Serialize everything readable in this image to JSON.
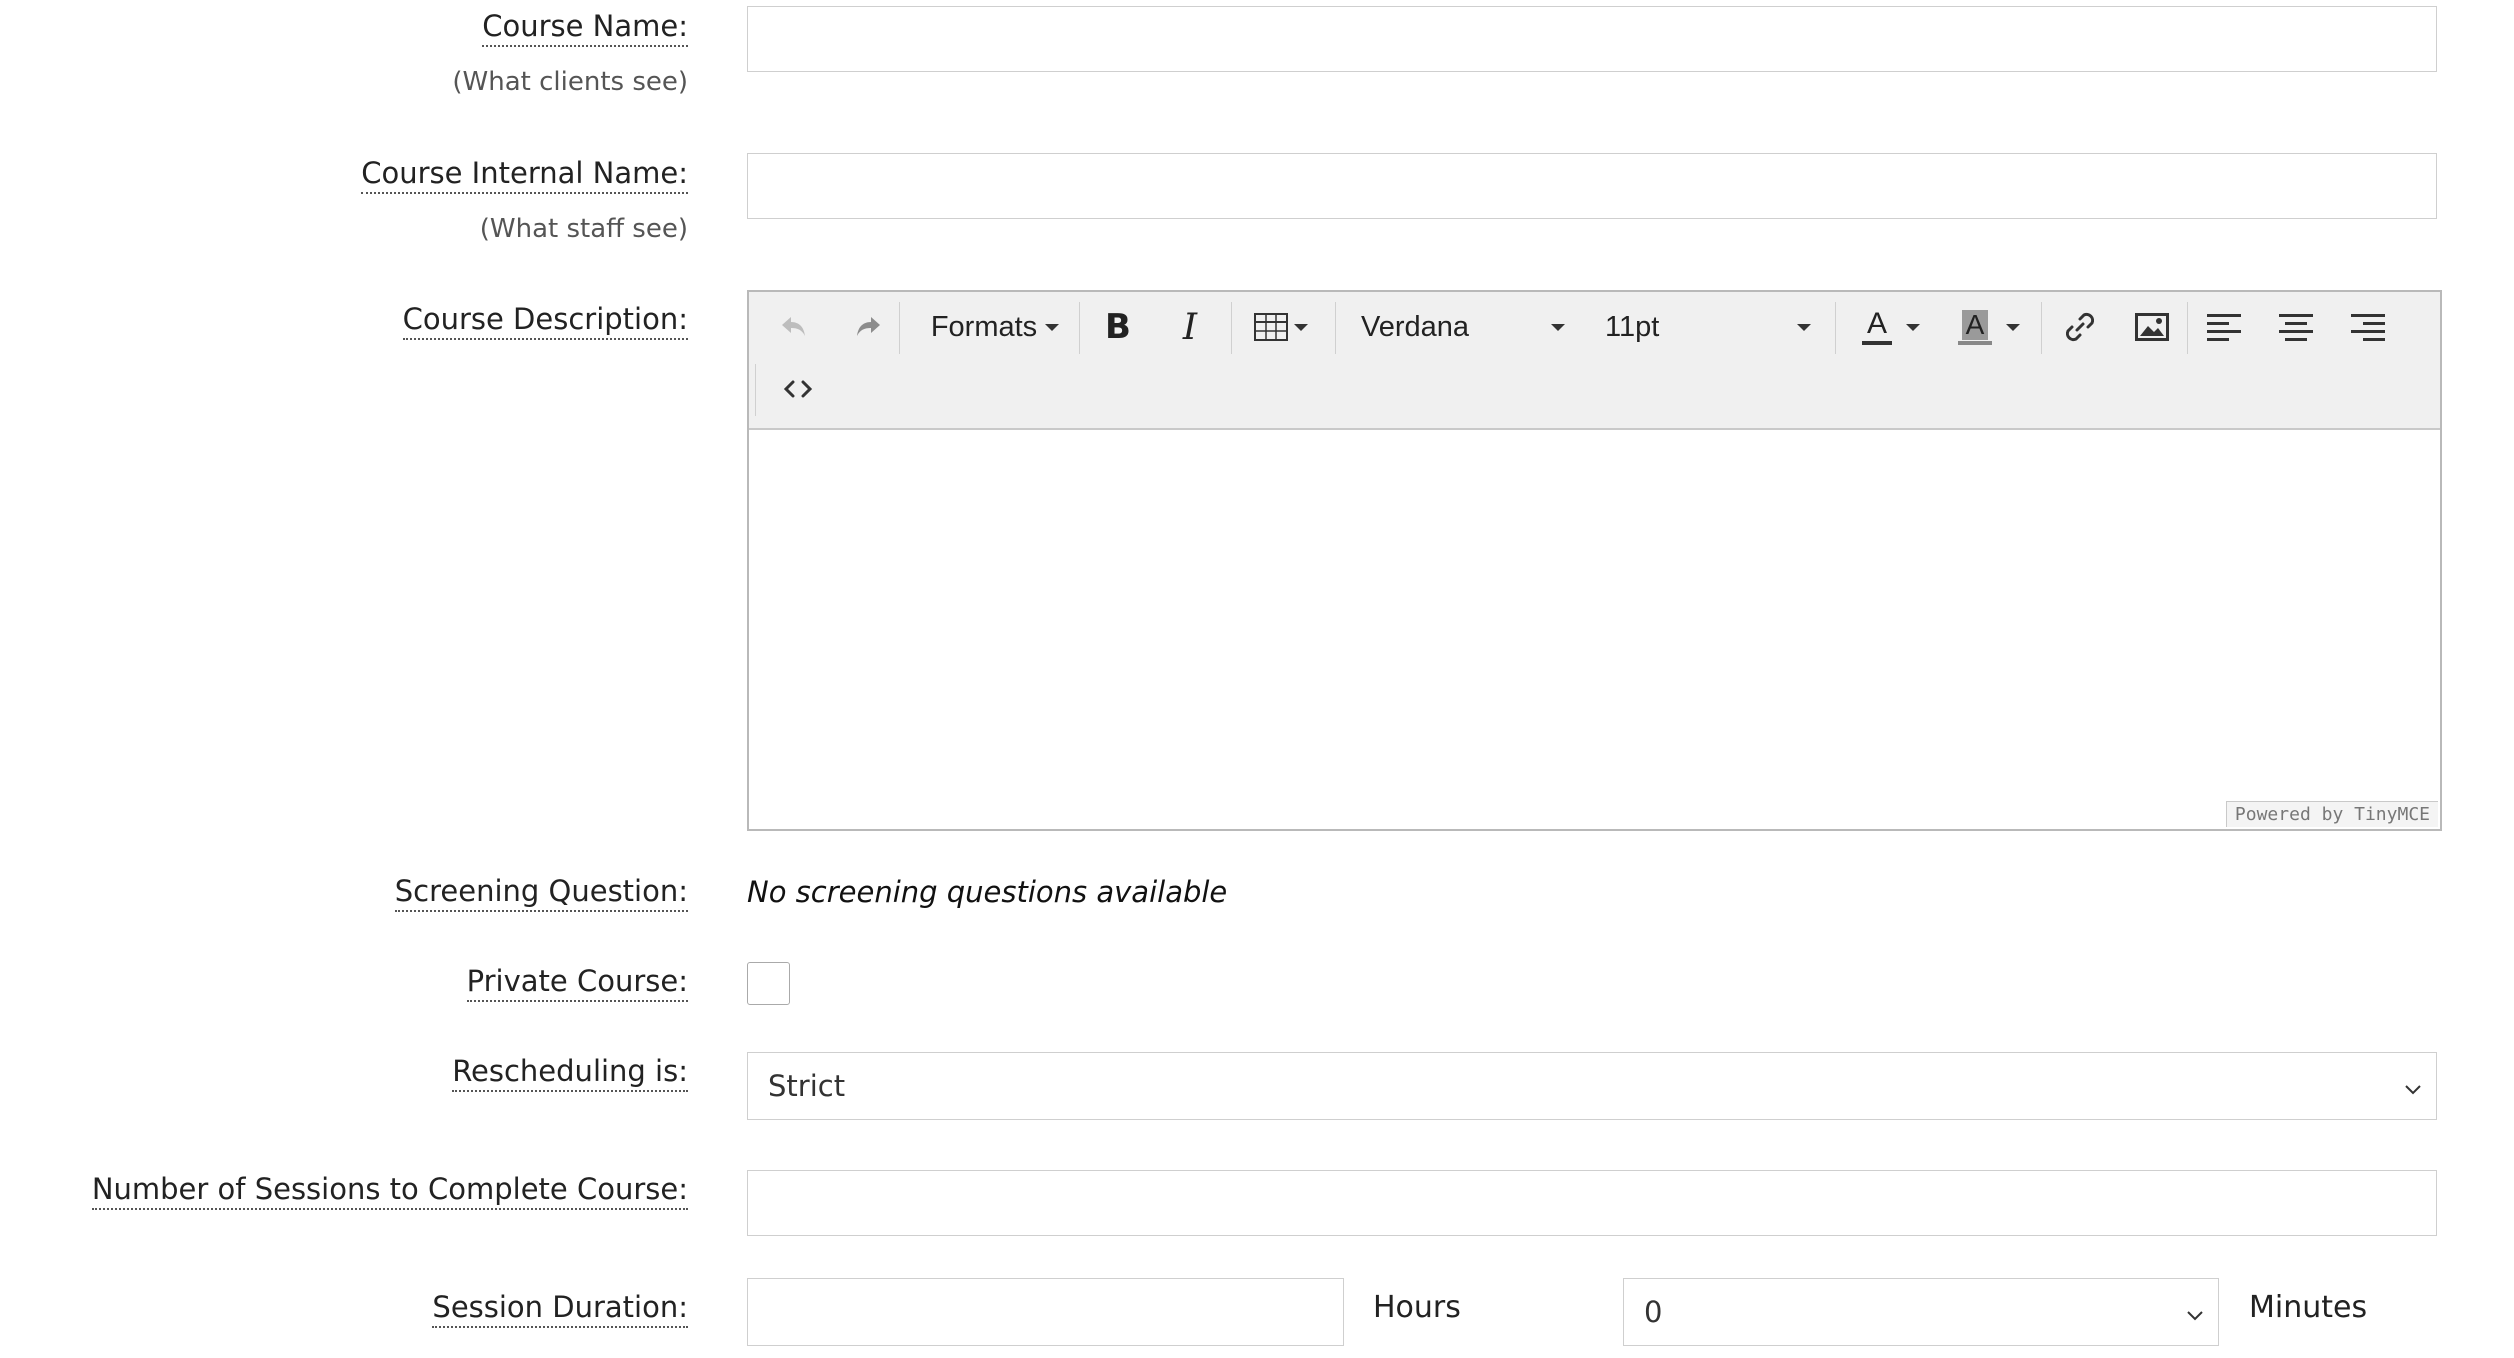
{
  "form": {
    "course_name": {
      "label": "Course Name:",
      "hint": "(What clients see)",
      "value": ""
    },
    "course_internal_name": {
      "label": "Course Internal Name:",
      "hint": "(What staff see)",
      "value": ""
    },
    "course_description": {
      "label": "Course Description:",
      "toolbar": {
        "undo_icon": "undo-icon",
        "redo_icon": "redo-icon",
        "formats_label": "Formats",
        "bold_icon": "bold-icon",
        "italic_icon": "italic-icon",
        "table_icon": "table-icon",
        "font_family": "Verdana",
        "font_size": "11pt",
        "text_color_icon": "text-color-icon",
        "bg_color_icon": "background-color-icon",
        "link_icon": "link-icon",
        "image_icon": "image-icon",
        "align_left_icon": "align-left-icon",
        "align_center_icon": "align-center-icon",
        "align_right_icon": "align-right-icon",
        "source_code_icon": "source-code-icon"
      },
      "powered_by": "Powered by TinyMCE"
    },
    "screening_question": {
      "label": "Screening Question:",
      "value": "No screening questions available"
    },
    "private_course": {
      "label": "Private Course:",
      "checked": false
    },
    "rescheduling": {
      "label": "Rescheduling is:",
      "selected": "Strict"
    },
    "sessions_to_complete": {
      "label": "Number of Sessions to Complete Course:",
      "value": ""
    },
    "session_duration": {
      "label": "Session Duration:",
      "hours_value": "",
      "hours_unit": "Hours",
      "minutes_selected": "0",
      "minutes_unit": "Minutes"
    }
  }
}
